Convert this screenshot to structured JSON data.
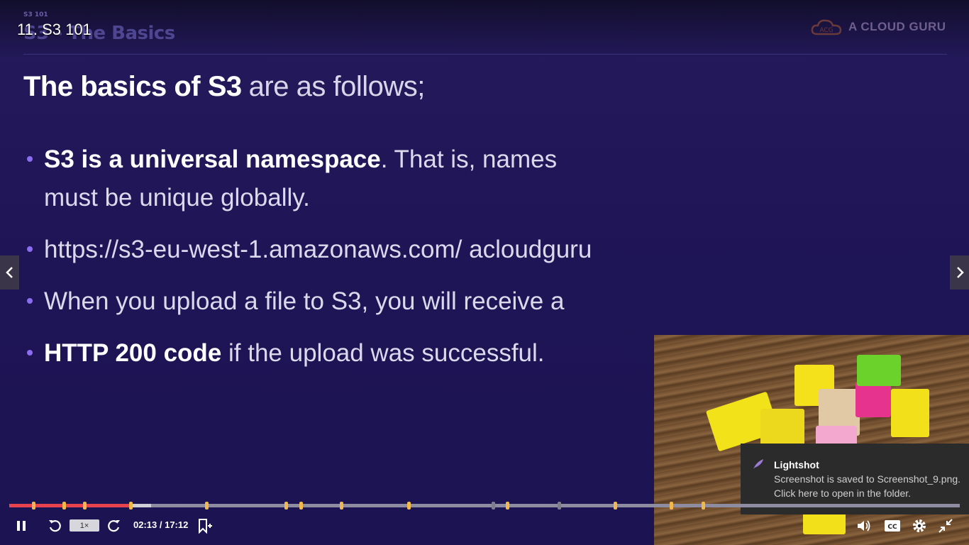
{
  "video": {
    "title": "11. S3 101"
  },
  "slide": {
    "crumb": "S3 101",
    "heading": "S3 - The Basics",
    "brand": "A CLOUD GURU",
    "title_bold": "The basics of S3",
    "title_rest": "are as follows;",
    "bullets": [
      {
        "bold": "S3 is a universal namespace",
        "text": ". That is, names must be unique globally."
      },
      {
        "bold": "",
        "text": "https://s3-eu-west-1.amazonaws.com/ acloudguru"
      },
      {
        "bold": "",
        "text": "When you upload a file to S3, you will receive a"
      },
      {
        "bold": "HTTP 200 code",
        "text": " if the upload was successful."
      }
    ]
  },
  "toast": {
    "title": "Lightshot",
    "line1": "Screenshot is saved to Screenshot_9.png.",
    "line2": "Click here to open in the folder."
  },
  "player": {
    "speed": "1×",
    "time": "02:13 / 17:12",
    "progress_played_fraction": 0.128,
    "progress_buffered_fraction": 0.149,
    "colors": {
      "played": "#e8424f",
      "marker": "#f2b84b"
    }
  },
  "icons": {
    "pause": "pause-icon",
    "rewind": "rewind-icon",
    "forward": "forward-icon",
    "bookmark": "bookmark-add-icon",
    "volume": "volume-icon",
    "captions": "captions-icon",
    "settings": "settings-icon",
    "exit_fullscreen": "exit-fullscreen-icon",
    "prev": "chevron-left-icon",
    "next": "chevron-right-icon"
  }
}
